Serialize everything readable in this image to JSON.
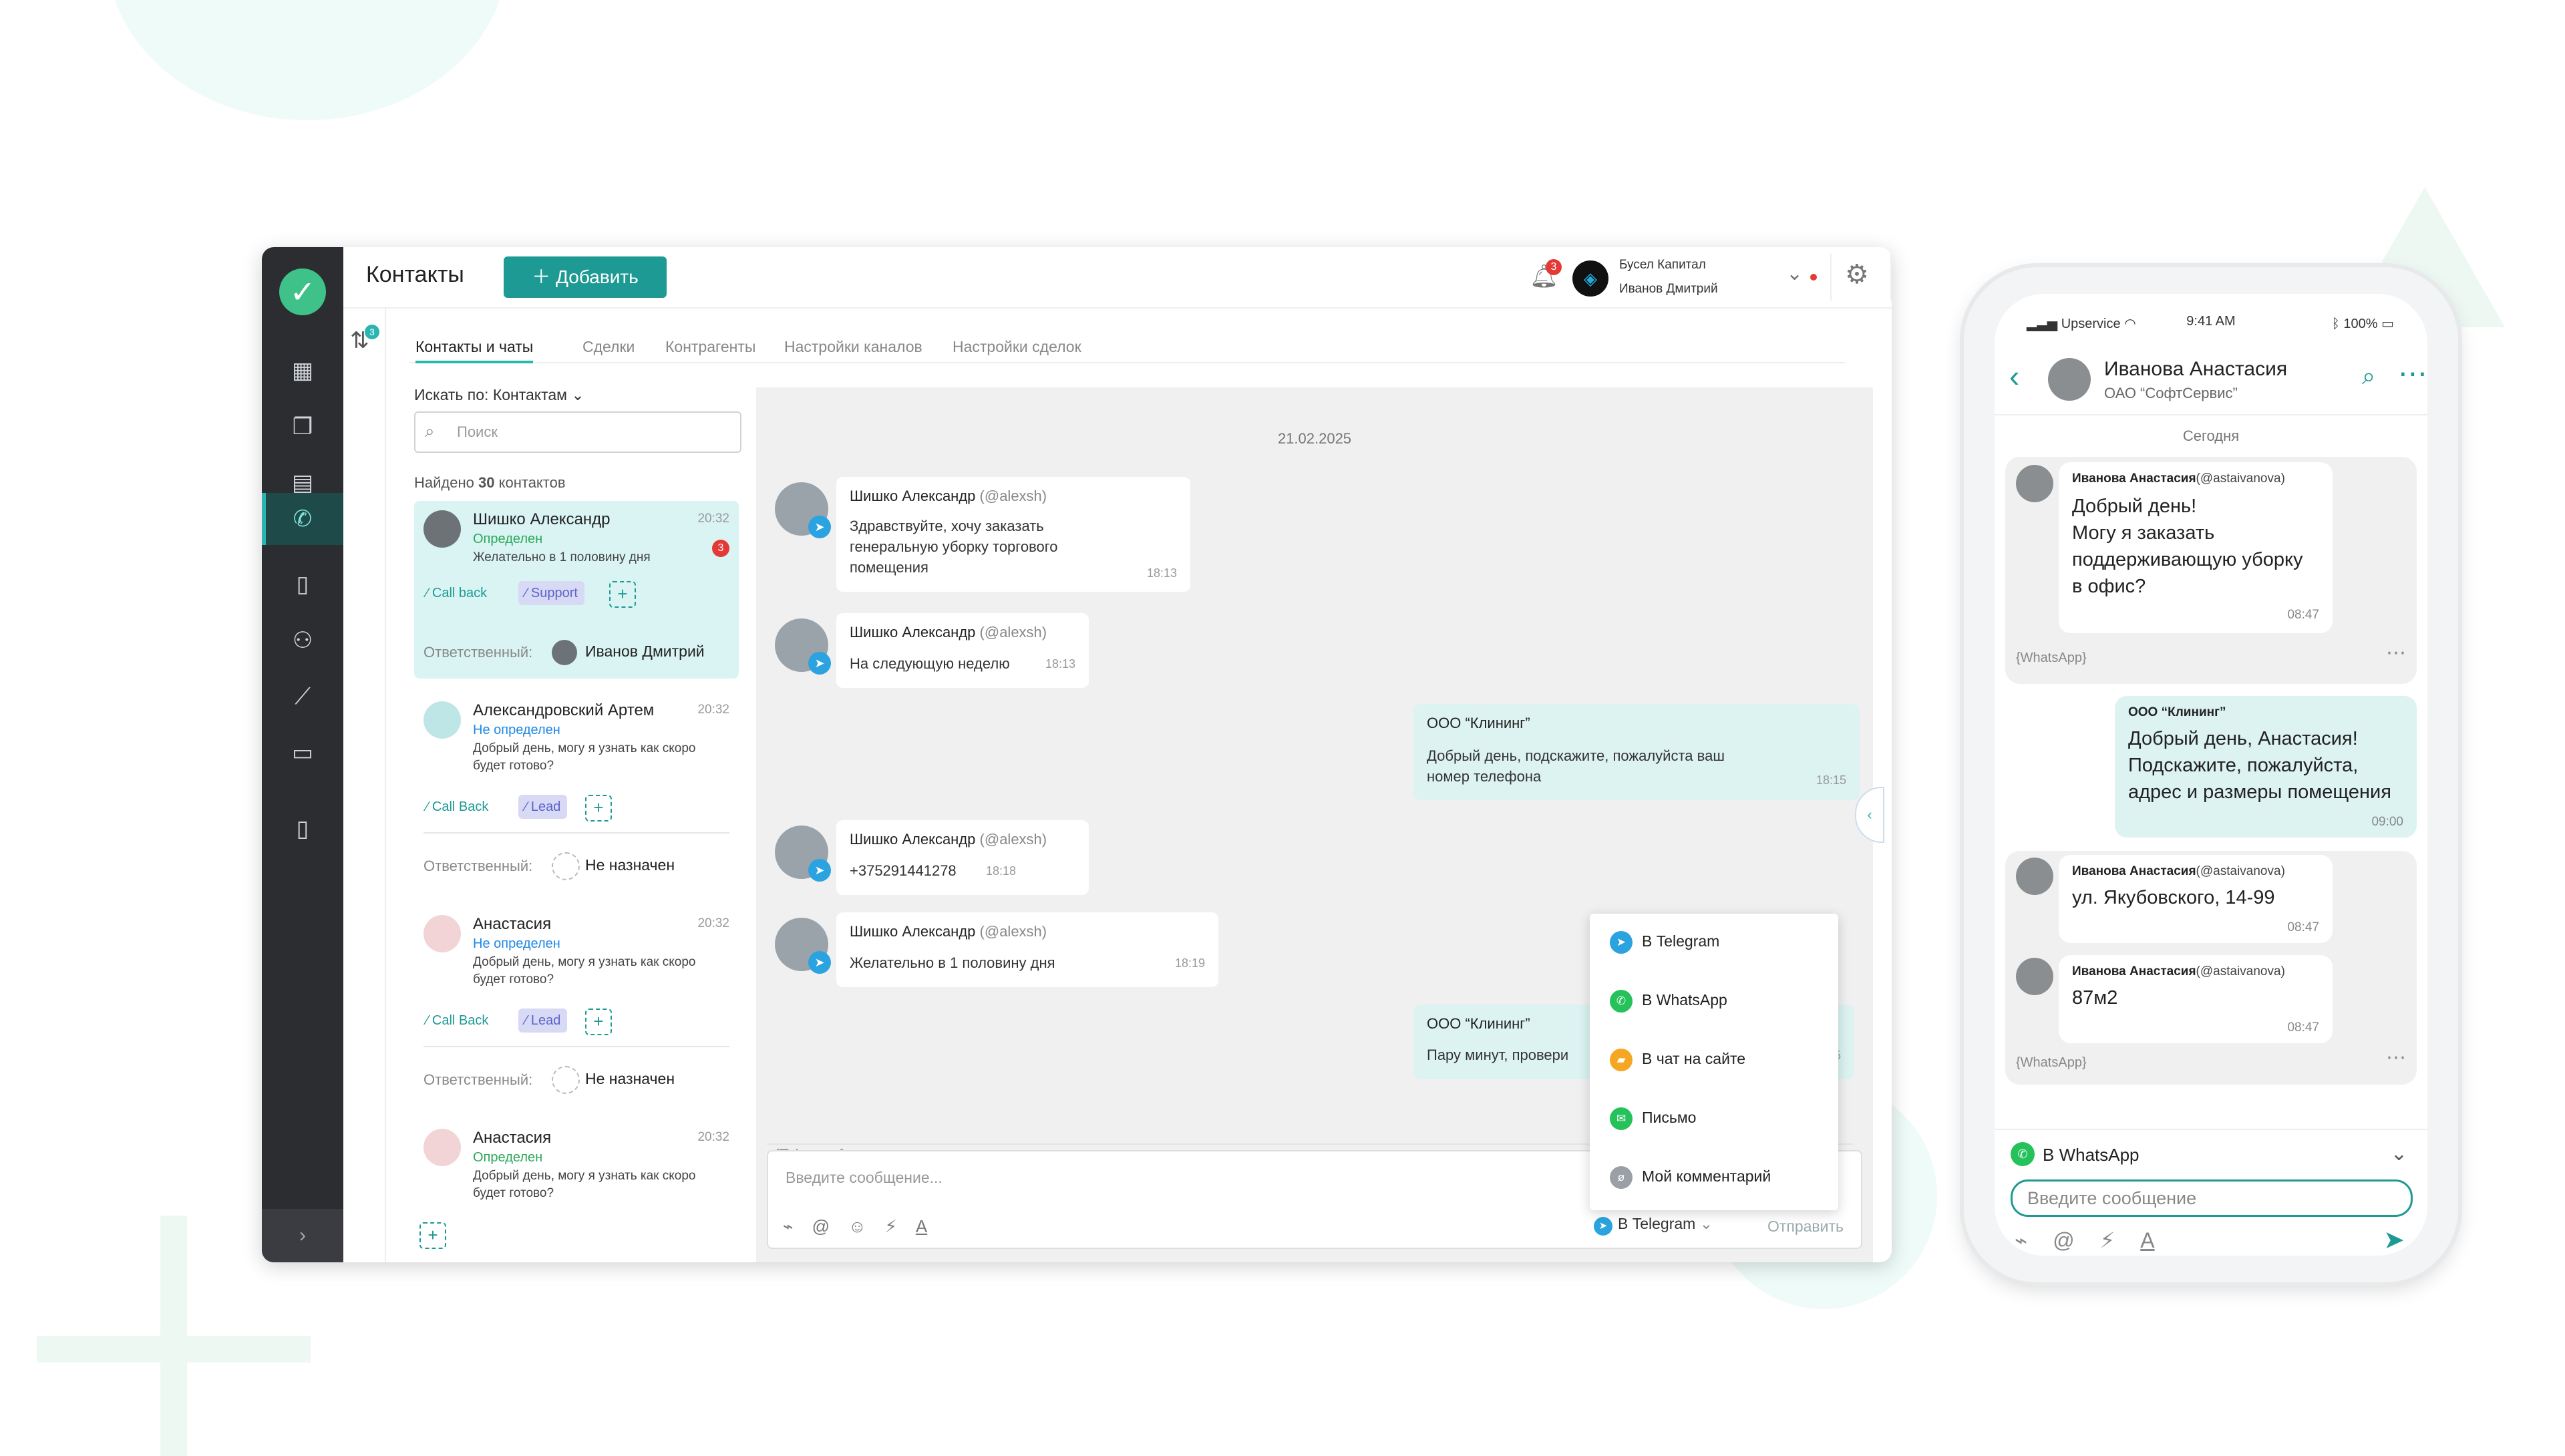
{
  "window": {
    "title": "Контакты",
    "add_button": "Добавить",
    "notifications_count": "3",
    "company": "Бусел Капитал",
    "user": "Иванов Дмитрий",
    "filter_badge": "3",
    "rail_icons": [
      "dashboard-icon",
      "copy-icon",
      "invoice-icon",
      "phone-icon",
      "book-icon",
      "users-icon",
      "chart-icon",
      "folder-icon",
      "mobile-icon"
    ]
  },
  "tabs": [
    "Контакты и чаты",
    "Сделки",
    "Контрагенты",
    "Настройки каналов",
    "Настройки сделок"
  ],
  "list": {
    "search_by": "Искать по: Контактам",
    "search_placeholder": "Поиск",
    "found_prefix": "Найдено",
    "found_count": "30",
    "found_suffix": "контактов",
    "responsible_label": "Ответственный:",
    "contacts": [
      {
        "name": "Шишко Александр",
        "time": "20:32",
        "status": "Определен",
        "message": "Желательно в 1 половину дня",
        "unread": "3",
        "tags": [
          "Call back",
          "Support"
        ],
        "responsible": "Иванов Дмитрий"
      },
      {
        "name": "Александровский Артем",
        "time": "20:32",
        "status": "Не определен",
        "message": "Добрый день, могу я узнать как скоро будет готово?",
        "tags": [
          "Call Back",
          "Lead"
        ],
        "responsible": "Не назначен"
      },
      {
        "name": "Анастасия",
        "time": "20:32",
        "status": "Не определен",
        "message": "Добрый день, могу я узнать как скоро будет готово?",
        "tags": [
          "Call Back",
          "Lead"
        ],
        "responsible": "Не назначен"
      },
      {
        "name": "Анастасия",
        "time": "20:32",
        "status": "Определен",
        "message": "Добрый день, могу я узнать как скоро будет готово?"
      }
    ]
  },
  "chat": {
    "date": "21.02.2025",
    "messages": [
      {
        "name": "Шишко Александр",
        "handle": "(@alexsh)",
        "text": [
          "Здравствуйте, хочу заказать",
          "генеральную уборку торгового",
          "помещения"
        ],
        "time": "18:13"
      },
      {
        "name": "Шишко Александр",
        "handle": "(@alexsh)",
        "text": [
          "На следующую неделю"
        ],
        "time": "18:13"
      },
      {
        "name": "ООО “Клининг”",
        "text": [
          "Добрый день, подскажите, пожалуйста ваш",
          "номер телефона"
        ],
        "time": "18:15"
      },
      {
        "name": "Шишко Александр",
        "handle": "(@alexsh)",
        "text": [
          "+375291441278"
        ],
        "time": "18:18"
      },
      {
        "name": "Шишко Александр",
        "handle": "(@alexsh)",
        "text": [
          "Желательно в 1 половину дня"
        ],
        "time": "18:19"
      },
      {
        "name": "ООО “Клининг”",
        "text": [
          "Пару минут, провери"
        ],
        "time": "5"
      }
    ],
    "source": "{Telegram}",
    "source_right": "ты",
    "compose_placeholder": "Введите сообщение...",
    "channel": "В Telegram",
    "send": "Отправить"
  },
  "dropdown": [
    {
      "label": "В Telegram",
      "color": "#2aa3e0",
      "icon": "telegram-icon"
    },
    {
      "label": "В WhatsApp",
      "color": "#25c15a",
      "icon": "whatsapp-icon"
    },
    {
      "label": "В чат на сайте",
      "color": "#f5a623",
      "icon": "chat-icon"
    },
    {
      "label": "Письмо",
      "color": "#25c15a",
      "icon": "mail-icon"
    },
    {
      "label": "Мой комментарий",
      "color": "#9aa0a6",
      "icon": "eye-off-icon"
    }
  ],
  "phone": {
    "carrier": "Upservice",
    "time": "9:41 AM",
    "battery": "100%",
    "contact_name": "Иванова Анастасия",
    "org": "ОАО “СофтСервис”",
    "today": "Сегодня",
    "messages": [
      {
        "name": "Иванова Анастасия",
        "handle": "(@astaivanova)",
        "text": [
          "Добрый день!",
          "Могу я заказать",
          "поддерживающую уборку",
          "в офис?"
        ],
        "time": "08:47"
      },
      {
        "name": "ООО “Клининг”",
        "text": [
          "Добрый день, Анастасия!",
          "Подскажите, пожалуйста,",
          "адрес и размеры помещения"
        ],
        "time": "09:00"
      },
      {
        "name": "Иванова Анастасия",
        "handle": "(@astaivanova)",
        "text": [
          "ул. Якубовского, 14-99"
        ],
        "time": "08:47"
      },
      {
        "name": "Иванова Анастасия",
        "handle": "(@astaivanova)",
        "text": [
          "87м2"
        ],
        "time": "08:47"
      }
    ],
    "source": "{WhatsApp}",
    "channel": "В WhatsApp",
    "input_placeholder": "Введите сообщение"
  }
}
